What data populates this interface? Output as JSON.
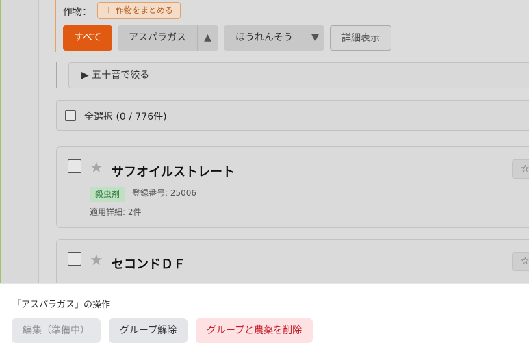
{
  "filters": {
    "crops_label": "作物：",
    "merge_button": "＋ 作物をまとめる",
    "all_chip": "すべて",
    "groups": [
      {
        "label": "アスパラガス",
        "arrow": "▲"
      },
      {
        "label": "ほうれんそう",
        "arrow": "▼"
      }
    ],
    "detail_toggle": "詳細表示",
    "kana_filter": "▶ 五十音で絞る"
  },
  "selection": {
    "label": "全選択 (0 / 776件)"
  },
  "products": [
    {
      "star": "★",
      "name": "サフオイルストレート",
      "tag": "殺虫剤",
      "reg": "登録番号: 25006",
      "detail": "適用詳細: 2件",
      "fav": "☆"
    },
    {
      "star": "★",
      "name": "セコンドＤＦ",
      "tag": "",
      "reg": "",
      "detail": "",
      "fav": "☆"
    }
  ],
  "action_sheet": {
    "title": "「アスパラガス」の操作",
    "edit_button": "編集（準備中）",
    "ungroup_button": "グループ解除",
    "delete_button": "グループと農薬を削除"
  },
  "colors": {
    "accent": "#e05a12",
    "tag_bg": "#bfe0c2",
    "delete_text": "#c61d2a",
    "delete_bg": "#fde1e3"
  }
}
